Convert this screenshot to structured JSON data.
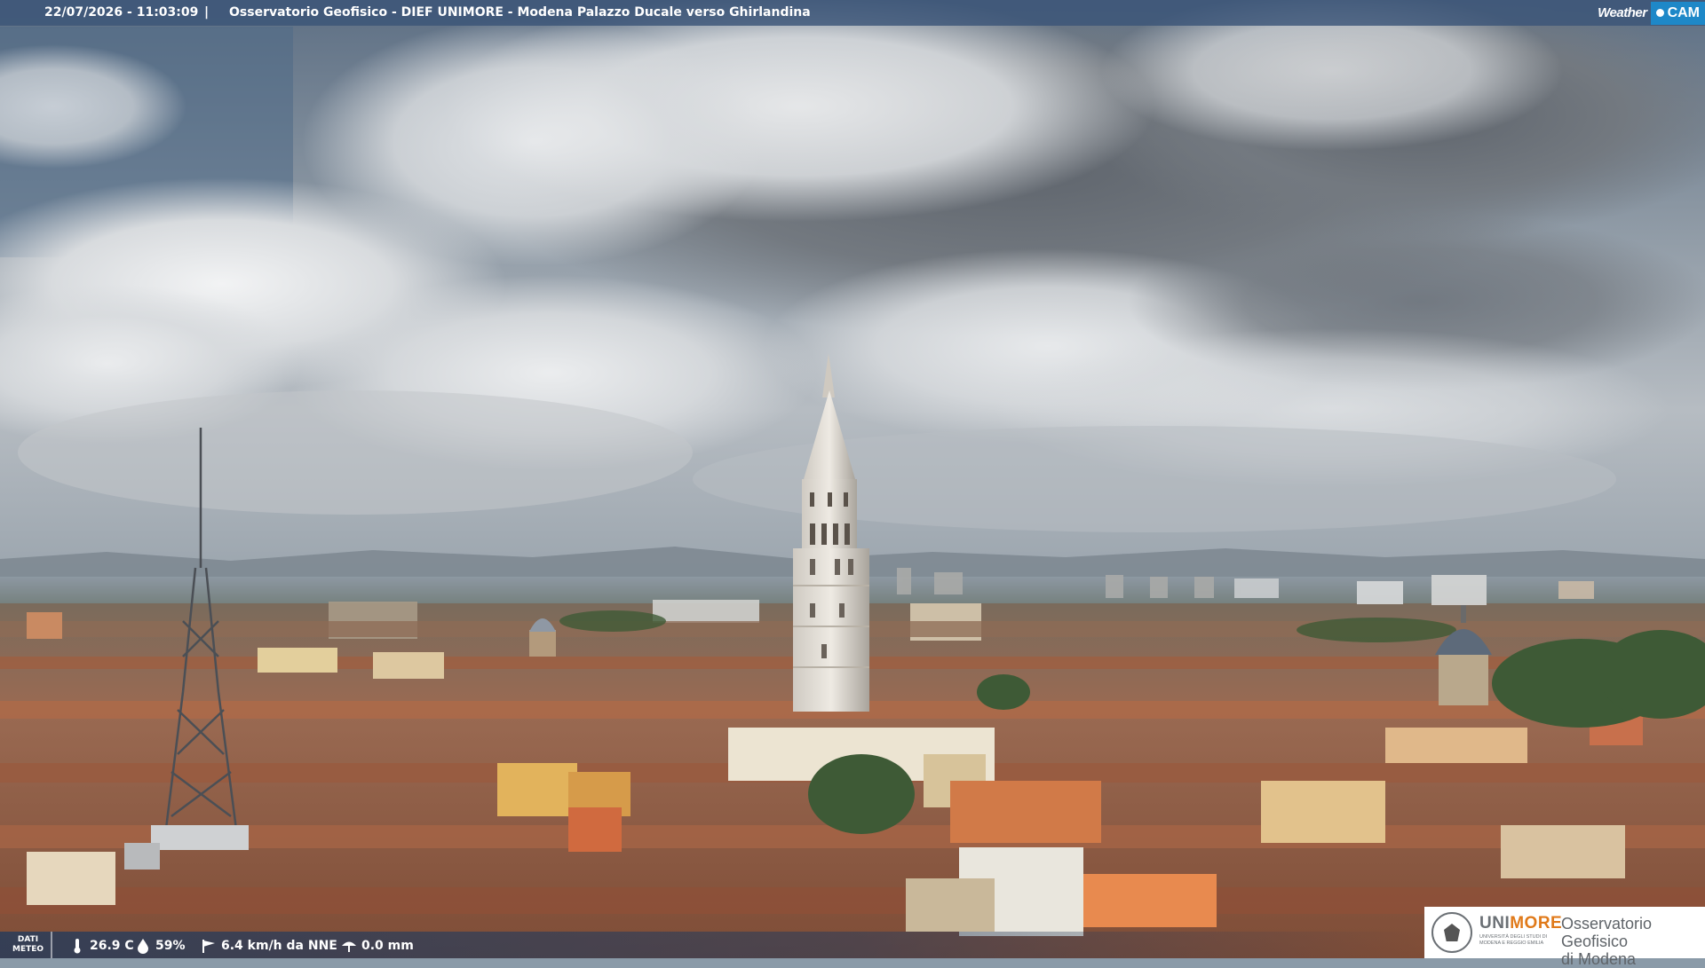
{
  "header": {
    "timestamp": "22/07/2026 - 11:03:09",
    "separator": "|",
    "title": "Osservatorio Geofisico - DIEF UNIMORE - Modena Palazzo Ducale verso Ghirlandina",
    "brand_weather": "Weather",
    "brand_cam": "CAM"
  },
  "footer": {
    "dati_meteo_line1": "DATI",
    "dati_meteo_line2": "METEO",
    "temperature": "26.9 C",
    "humidity": "59%",
    "wind": "6.4 km/h da NNE",
    "rain": "0.0 mm",
    "icons": {
      "temperature": "thermometer-icon",
      "humidity": "humidity-drop-icon",
      "wind": "wind-vane-icon",
      "rain": "rain-umbrella-icon"
    }
  },
  "logo": {
    "unimore_a": "UNI",
    "unimore_b": "MORE",
    "sub_line1": "UNIVERSITÀ DEGLI STUDI DI",
    "sub_line2": "MODENA E REGGIO EMILIA",
    "osservatorio_line1": "Osservatorio Geofisico",
    "osservatorio_line2": "di Modena"
  },
  "colors": {
    "sky_top": "#6d7f92",
    "cloud_light": "#e6e8ea",
    "cloud_dark": "#7a8088",
    "roof": "#a8674a",
    "wall": "#d9b98c",
    "accent_orange": "#e07a1a",
    "bar_blue": "#3a5478",
    "weathercam_blue": "#1e88c8"
  }
}
